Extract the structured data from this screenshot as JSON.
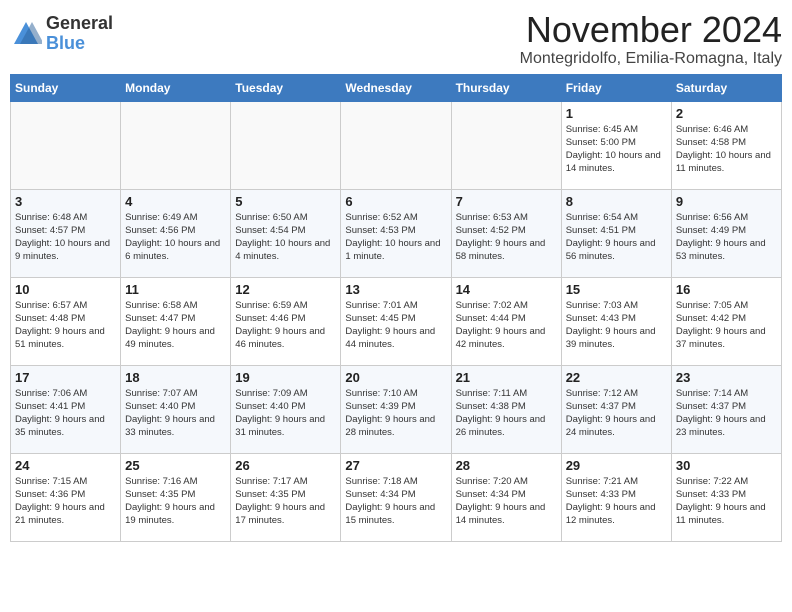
{
  "header": {
    "logo_general": "General",
    "logo_blue": "Blue",
    "month": "November 2024",
    "location": "Montegridolfo, Emilia-Romagna, Italy"
  },
  "days_of_week": [
    "Sunday",
    "Monday",
    "Tuesday",
    "Wednesday",
    "Thursday",
    "Friday",
    "Saturday"
  ],
  "weeks": [
    [
      {
        "day": "",
        "info": ""
      },
      {
        "day": "",
        "info": ""
      },
      {
        "day": "",
        "info": ""
      },
      {
        "day": "",
        "info": ""
      },
      {
        "day": "",
        "info": ""
      },
      {
        "day": "1",
        "info": "Sunrise: 6:45 AM\nSunset: 5:00 PM\nDaylight: 10 hours and 14 minutes."
      },
      {
        "day": "2",
        "info": "Sunrise: 6:46 AM\nSunset: 4:58 PM\nDaylight: 10 hours and 11 minutes."
      }
    ],
    [
      {
        "day": "3",
        "info": "Sunrise: 6:48 AM\nSunset: 4:57 PM\nDaylight: 10 hours and 9 minutes."
      },
      {
        "day": "4",
        "info": "Sunrise: 6:49 AM\nSunset: 4:56 PM\nDaylight: 10 hours and 6 minutes."
      },
      {
        "day": "5",
        "info": "Sunrise: 6:50 AM\nSunset: 4:54 PM\nDaylight: 10 hours and 4 minutes."
      },
      {
        "day": "6",
        "info": "Sunrise: 6:52 AM\nSunset: 4:53 PM\nDaylight: 10 hours and 1 minute."
      },
      {
        "day": "7",
        "info": "Sunrise: 6:53 AM\nSunset: 4:52 PM\nDaylight: 9 hours and 58 minutes."
      },
      {
        "day": "8",
        "info": "Sunrise: 6:54 AM\nSunset: 4:51 PM\nDaylight: 9 hours and 56 minutes."
      },
      {
        "day": "9",
        "info": "Sunrise: 6:56 AM\nSunset: 4:49 PM\nDaylight: 9 hours and 53 minutes."
      }
    ],
    [
      {
        "day": "10",
        "info": "Sunrise: 6:57 AM\nSunset: 4:48 PM\nDaylight: 9 hours and 51 minutes."
      },
      {
        "day": "11",
        "info": "Sunrise: 6:58 AM\nSunset: 4:47 PM\nDaylight: 9 hours and 49 minutes."
      },
      {
        "day": "12",
        "info": "Sunrise: 6:59 AM\nSunset: 4:46 PM\nDaylight: 9 hours and 46 minutes."
      },
      {
        "day": "13",
        "info": "Sunrise: 7:01 AM\nSunset: 4:45 PM\nDaylight: 9 hours and 44 minutes."
      },
      {
        "day": "14",
        "info": "Sunrise: 7:02 AM\nSunset: 4:44 PM\nDaylight: 9 hours and 42 minutes."
      },
      {
        "day": "15",
        "info": "Sunrise: 7:03 AM\nSunset: 4:43 PM\nDaylight: 9 hours and 39 minutes."
      },
      {
        "day": "16",
        "info": "Sunrise: 7:05 AM\nSunset: 4:42 PM\nDaylight: 9 hours and 37 minutes."
      }
    ],
    [
      {
        "day": "17",
        "info": "Sunrise: 7:06 AM\nSunset: 4:41 PM\nDaylight: 9 hours and 35 minutes."
      },
      {
        "day": "18",
        "info": "Sunrise: 7:07 AM\nSunset: 4:40 PM\nDaylight: 9 hours and 33 minutes."
      },
      {
        "day": "19",
        "info": "Sunrise: 7:09 AM\nSunset: 4:40 PM\nDaylight: 9 hours and 31 minutes."
      },
      {
        "day": "20",
        "info": "Sunrise: 7:10 AM\nSunset: 4:39 PM\nDaylight: 9 hours and 28 minutes."
      },
      {
        "day": "21",
        "info": "Sunrise: 7:11 AM\nSunset: 4:38 PM\nDaylight: 9 hours and 26 minutes."
      },
      {
        "day": "22",
        "info": "Sunrise: 7:12 AM\nSunset: 4:37 PM\nDaylight: 9 hours and 24 minutes."
      },
      {
        "day": "23",
        "info": "Sunrise: 7:14 AM\nSunset: 4:37 PM\nDaylight: 9 hours and 23 minutes."
      }
    ],
    [
      {
        "day": "24",
        "info": "Sunrise: 7:15 AM\nSunset: 4:36 PM\nDaylight: 9 hours and 21 minutes."
      },
      {
        "day": "25",
        "info": "Sunrise: 7:16 AM\nSunset: 4:35 PM\nDaylight: 9 hours and 19 minutes."
      },
      {
        "day": "26",
        "info": "Sunrise: 7:17 AM\nSunset: 4:35 PM\nDaylight: 9 hours and 17 minutes."
      },
      {
        "day": "27",
        "info": "Sunrise: 7:18 AM\nSunset: 4:34 PM\nDaylight: 9 hours and 15 minutes."
      },
      {
        "day": "28",
        "info": "Sunrise: 7:20 AM\nSunset: 4:34 PM\nDaylight: 9 hours and 14 minutes."
      },
      {
        "day": "29",
        "info": "Sunrise: 7:21 AM\nSunset: 4:33 PM\nDaylight: 9 hours and 12 minutes."
      },
      {
        "day": "30",
        "info": "Sunrise: 7:22 AM\nSunset: 4:33 PM\nDaylight: 9 hours and 11 minutes."
      }
    ]
  ]
}
